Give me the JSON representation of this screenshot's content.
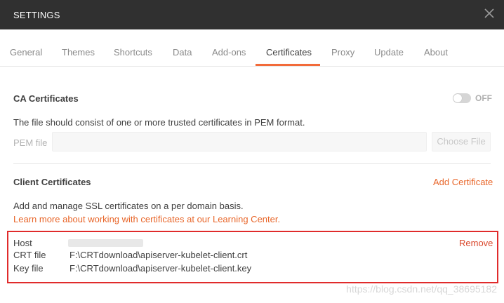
{
  "window": {
    "title": "SETTINGS"
  },
  "tabs": [
    {
      "label": "General"
    },
    {
      "label": "Themes"
    },
    {
      "label": "Shortcuts"
    },
    {
      "label": "Data"
    },
    {
      "label": "Add-ons"
    },
    {
      "label": "Certificates",
      "active": true
    },
    {
      "label": "Proxy"
    },
    {
      "label": "Update"
    },
    {
      "label": "About"
    }
  ],
  "ca": {
    "title": "CA Certificates",
    "toggle_label": "OFF",
    "toggle_on": false,
    "description": "The file should consist of one or more trusted certificates in PEM format.",
    "pem_label": "PEM file",
    "pem_value": "",
    "choose_label": "Choose File"
  },
  "client": {
    "title": "Client Certificates",
    "add_label": "Add Certificate",
    "description": "Add and manage SSL certificates on a per domain basis.",
    "learn_link": "Learn more about working with certificates at our Learning Center.",
    "entry": {
      "host_label": "Host",
      "host_value": "",
      "remove_label": "Remove",
      "crt_label": "CRT file",
      "crt_value": "F:\\CRTdownload\\apiserver-kubelet-client.crt",
      "key_label": "Key file",
      "key_value": "F:\\CRTdownload\\apiserver-kubelet-client.key"
    }
  },
  "watermark": "https://blog.csdn.net/qq_38695182",
  "colors": {
    "accent": "#f26b3a",
    "titlebar": "#303030",
    "highlight_box": "#e02b2b"
  }
}
